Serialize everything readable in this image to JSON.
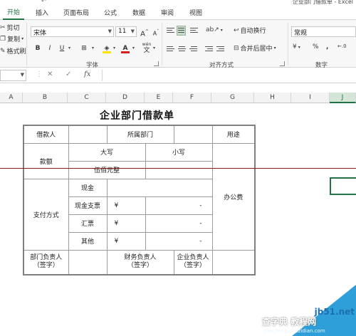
{
  "window": {
    "title": "企业部门借款单 - Excel"
  },
  "tabs": [
    "开始",
    "插入",
    "页面布局",
    "公式",
    "数据",
    "审阅",
    "视图"
  ],
  "clipboard": {
    "cut": "剪切",
    "copy": "复制",
    "format_painter": "格式刷"
  },
  "font": {
    "name": "宋体",
    "size": "11",
    "grow": "A",
    "shrink": "A",
    "bold": "B",
    "italic": "I",
    "underline": "U",
    "wen_label": "wén",
    "wen_char": "文",
    "fill_color": "#ffe600",
    "font_color": "#d62020",
    "group_label": "字体"
  },
  "alignment": {
    "wrap_text": "自动换行",
    "merge_center": "合并后居中",
    "group_label": "对齐方式"
  },
  "number": {
    "format": "常规",
    "percent": "%",
    "comma": ",",
    "group_label": "数字"
  },
  "formula_bar": {
    "cancel": "✕",
    "enter": "✓",
    "fx": "fx",
    "value": ""
  },
  "columns": [
    "A",
    "B",
    "C",
    "D",
    "E",
    "F",
    "G",
    "H",
    "I",
    "J"
  ],
  "form": {
    "title": "企业部门借款单",
    "borrower": "借款人",
    "department": "所属部门",
    "purpose": "用途",
    "amount": "款额",
    "amount_upper": "大写",
    "amount_lower": "小写",
    "amount_text": "伍佰元整",
    "purpose_value": "办公费",
    "payment_method": "支付方式",
    "cash": "现金",
    "cheque": "现金支票",
    "draft": "汇票",
    "other": "其他",
    "yen": "¥",
    "dash": "-",
    "dept_head": "部门负责人",
    "finance_head": "财务负责人",
    "company_head": "企业负责人",
    "signature": "（签字）"
  },
  "watermark": {
    "site": "jb51.net",
    "cn": "查字典 教程网",
    "url": "jiaocheng.chazidian.com"
  }
}
